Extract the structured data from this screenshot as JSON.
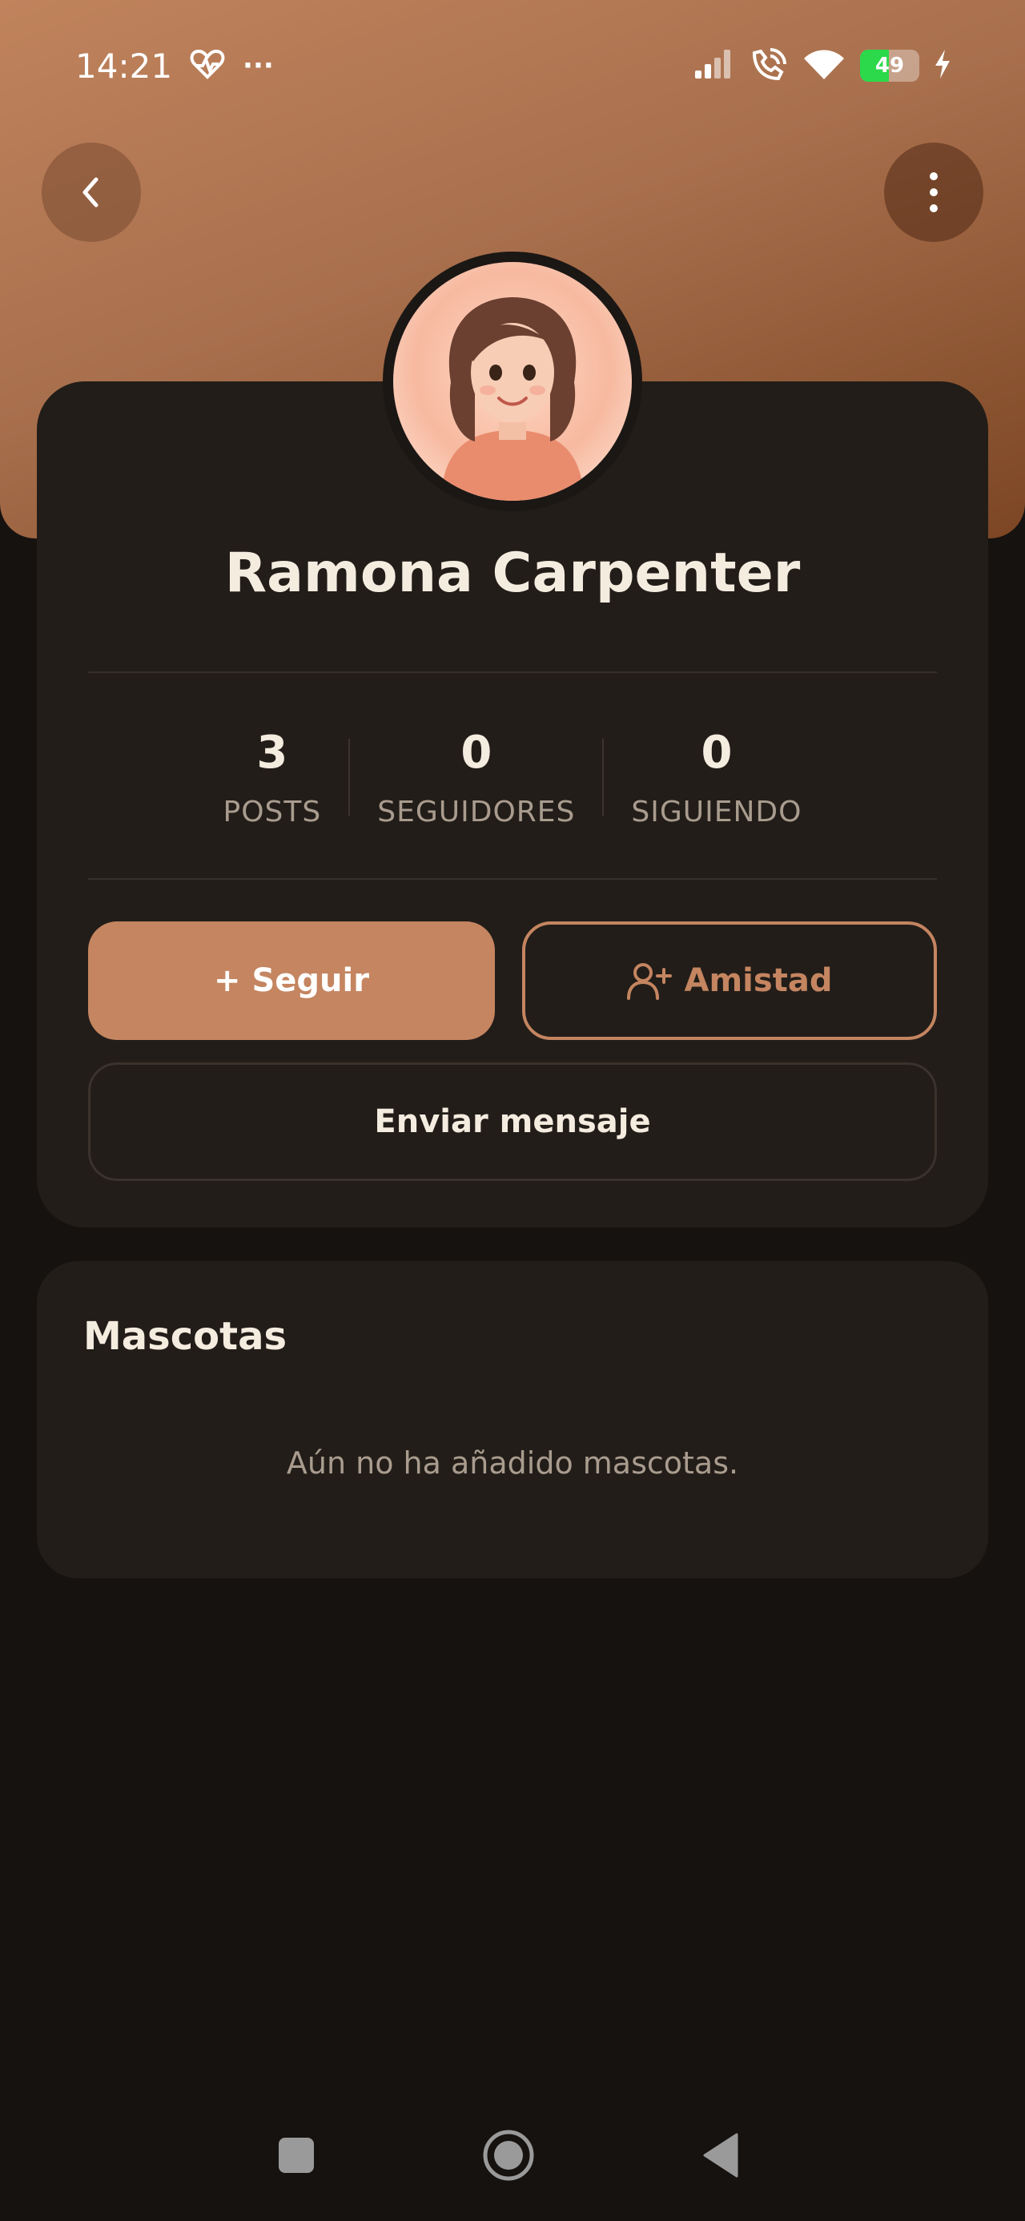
{
  "status_bar": {
    "time": "14:21",
    "more_indicator": "···",
    "battery_level": "49",
    "icons": [
      "heart-rate-icon",
      "signal-icon",
      "wifi-calling-icon",
      "wifi-icon",
      "battery-icon",
      "charging-icon"
    ]
  },
  "header": {
    "back_icon": "chevron-left-icon",
    "menu_icon": "more-vertical-icon"
  },
  "profile": {
    "name": "Ramona Carpenter",
    "avatar_icon": "avatar-image",
    "stats": [
      {
        "value": "3",
        "label": "POSTS"
      },
      {
        "value": "0",
        "label": "SEGUIDORES"
      },
      {
        "value": "0",
        "label": "SIGUIENDO"
      }
    ],
    "follow_label": "+ Seguir",
    "friend_label": "Amistad",
    "friend_icon": "user-plus-icon",
    "message_label": "Enviar mensaje"
  },
  "pets": {
    "title": "Mascotas",
    "empty_text": "Aún no ha añadido mascotas."
  },
  "nav": {
    "icons": [
      "recents-square-icon",
      "home-circle-icon",
      "back-triangle-icon"
    ]
  },
  "colors": {
    "accent": "#c48560",
    "background": "#151210",
    "card": "#221d19",
    "battery_green": "#2bd94a"
  }
}
